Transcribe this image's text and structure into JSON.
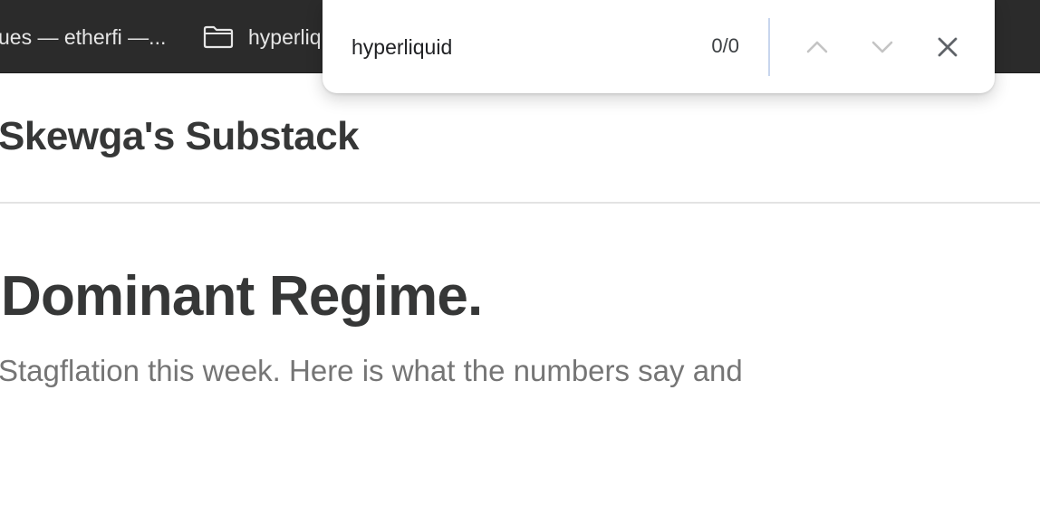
{
  "bookmarks_bar": {
    "items": [
      {
        "label": "ues — etherfi —..."
      },
      {
        "label": "hyperliquid",
        "icon": "folder-icon"
      }
    ]
  },
  "find_bar": {
    "query": "hyperliquid",
    "match_count": "0/0",
    "icons": [
      "chevron-up-icon",
      "chevron-down-icon",
      "close-icon"
    ]
  },
  "page": {
    "publication_title": "Skewga's Substack",
    "post_title": "Dominant Regime.",
    "post_subtitle": "Stagflation this week. Here is what the numbers say and"
  },
  "colors": {
    "toolbar_bg": "#2b2b2b",
    "title_text": "#363737",
    "subtitle_text": "#757575",
    "divider": "#e3e3e3"
  }
}
